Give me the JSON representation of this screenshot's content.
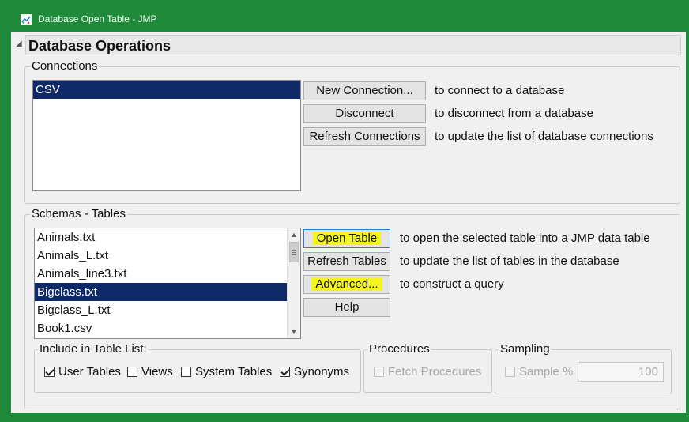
{
  "window": {
    "title": "Database Open Table - JMP",
    "icon": "jmp-app-icon"
  },
  "section": {
    "title": "Database Operations",
    "toggle": "◢"
  },
  "connections": {
    "label": "Connections",
    "items": [
      "CSV"
    ],
    "selected_index": 0,
    "buttons": [
      {
        "label": "New Connection...",
        "desc": "to connect to a database"
      },
      {
        "label": "Disconnect",
        "desc": "to disconnect from a database"
      },
      {
        "label": "Refresh Connections",
        "desc": "to update the list of database connections"
      }
    ]
  },
  "schemas": {
    "label": "Schemas - Tables",
    "items": [
      "Animals.txt",
      "Animals_L.txt",
      "Animals_line3.txt",
      "Bigclass.txt",
      "Bigclass_L.txt",
      "Book1.csv"
    ],
    "selected_index": 3,
    "buttons": [
      {
        "label": "Open Table",
        "desc": "to open the selected table into a JMP data table",
        "highlighted": true
      },
      {
        "label": "Refresh Tables",
        "desc": "to update the list of tables in the database",
        "highlighted": false
      },
      {
        "label": "Advanced...",
        "desc": "to construct a query",
        "highlighted": true
      },
      {
        "label": "Help",
        "desc": "",
        "highlighted": false
      }
    ],
    "highlight_color": "#f4f51d"
  },
  "include": {
    "label": "Include in Table List:",
    "options": [
      {
        "label": "User Tables",
        "checked": true
      },
      {
        "label": "Views",
        "checked": false
      },
      {
        "label": "System Tables",
        "checked": false
      },
      {
        "label": "Synonyms",
        "checked": true
      }
    ]
  },
  "procedures": {
    "label": "Procedures",
    "option": {
      "label": "Fetch Procedures",
      "checked": false,
      "enabled": false
    }
  },
  "sampling": {
    "label": "Sampling",
    "option": {
      "label": "Sample %",
      "checked": false,
      "enabled": false
    },
    "value": "100"
  },
  "colors": {
    "titlebar": "#1e8a3a",
    "selection": "#0f2868",
    "highlight": "#f4f51d"
  }
}
